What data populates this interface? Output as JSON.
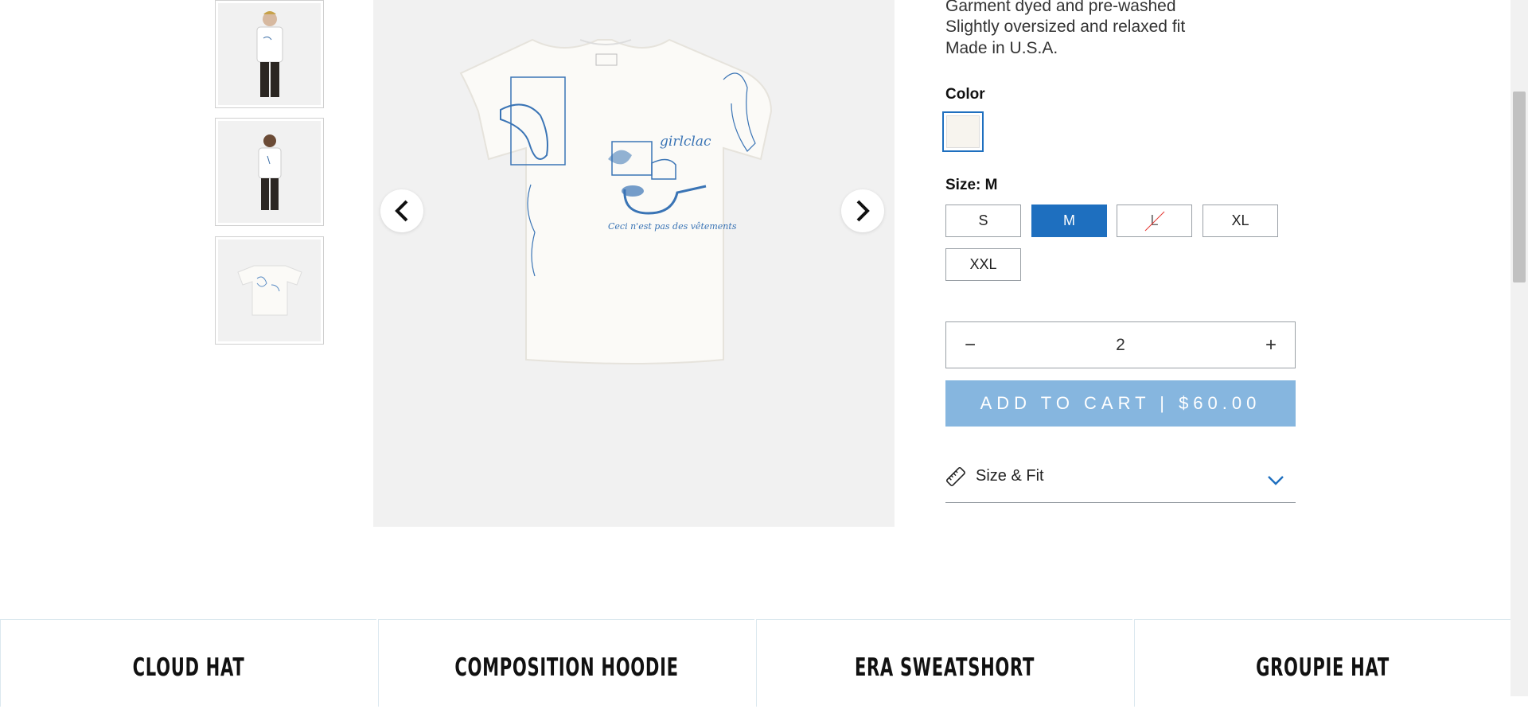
{
  "product": {
    "features": [
      "Garment dyed and pre-washed",
      "Slightly oversized and relaxed fit",
      "Made in U.S.A."
    ],
    "color_label": "Color",
    "size_label": "Size: M",
    "sizes": [
      {
        "label": "S",
        "state": "available"
      },
      {
        "label": "M",
        "state": "selected"
      },
      {
        "label": "L",
        "state": "sold-out"
      },
      {
        "label": "XL",
        "state": "available"
      },
      {
        "label": "XXL",
        "state": "available"
      }
    ],
    "quantity": "2",
    "qty_minus": "−",
    "qty_plus": "+",
    "add_to_cart": "ADD TO CART | $60.00",
    "size_fit_label": "Size & Fit",
    "shirt_print_text": "girlclac",
    "shirt_caption": "Ceci n'est pas des vêtements"
  },
  "thumbnails": [
    "front-model",
    "back-model",
    "flat-lay"
  ],
  "related": [
    {
      "title": "CLOUD HAT",
      "sub": ""
    },
    {
      "title": "COMPOSITION HOODIE",
      "sub": ""
    },
    {
      "title": "ERA SWEATSHORT",
      "sub": ""
    },
    {
      "title": "GROUPIE HAT",
      "sub": ""
    }
  ],
  "colors": {
    "accent": "#1e6fbf",
    "cart_button": "#86b6df",
    "sold_out_strike": "#e53935",
    "image_bg": "#f1f1f1",
    "swatch": "#f7f4ee"
  }
}
